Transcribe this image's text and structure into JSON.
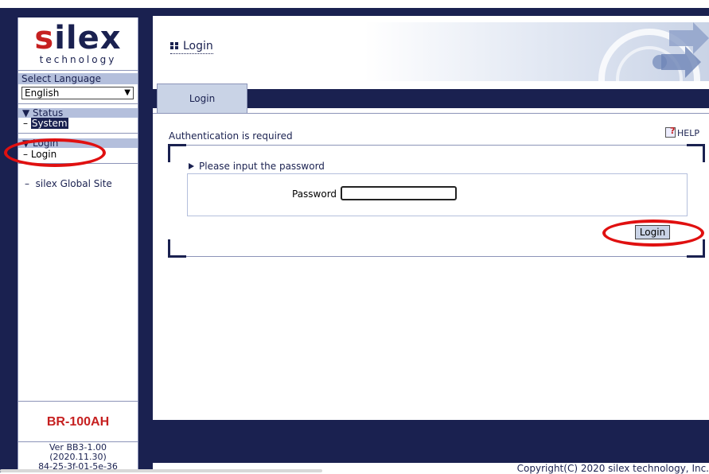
{
  "side": {
    "logo_main_red": "s",
    "logo_main_rest": "ilex",
    "logo_sub": "technology",
    "language_label": "Select Language",
    "language_value": "English",
    "nav": [
      {
        "head": "▼ Status",
        "item": "System"
      },
      {
        "head": "▼ Login",
        "item": "Login"
      }
    ],
    "global_link": "silex Global Site",
    "model": "BR-100AH",
    "version_lines": [
      "Ver BB3-1.00",
      "(2020.11.30)",
      "84-25-3f-01-5e-36"
    ]
  },
  "header": {
    "title": "Login"
  },
  "tabs": [
    {
      "label": "Login",
      "active": true
    }
  ],
  "content": {
    "auth_message": "Authentication is required",
    "help_label": "HELP",
    "prompt": "Please input the password",
    "password_label": "Password :",
    "password_value": "",
    "login_button": "Login"
  },
  "footer": {
    "copyright": "Copyright(C) 2020 silex technology, Inc."
  },
  "colors": {
    "navy": "#1a2150",
    "light_blue": "#b4bfdc",
    "brand_red": "#c62020",
    "annotation_red": "#e01010"
  }
}
